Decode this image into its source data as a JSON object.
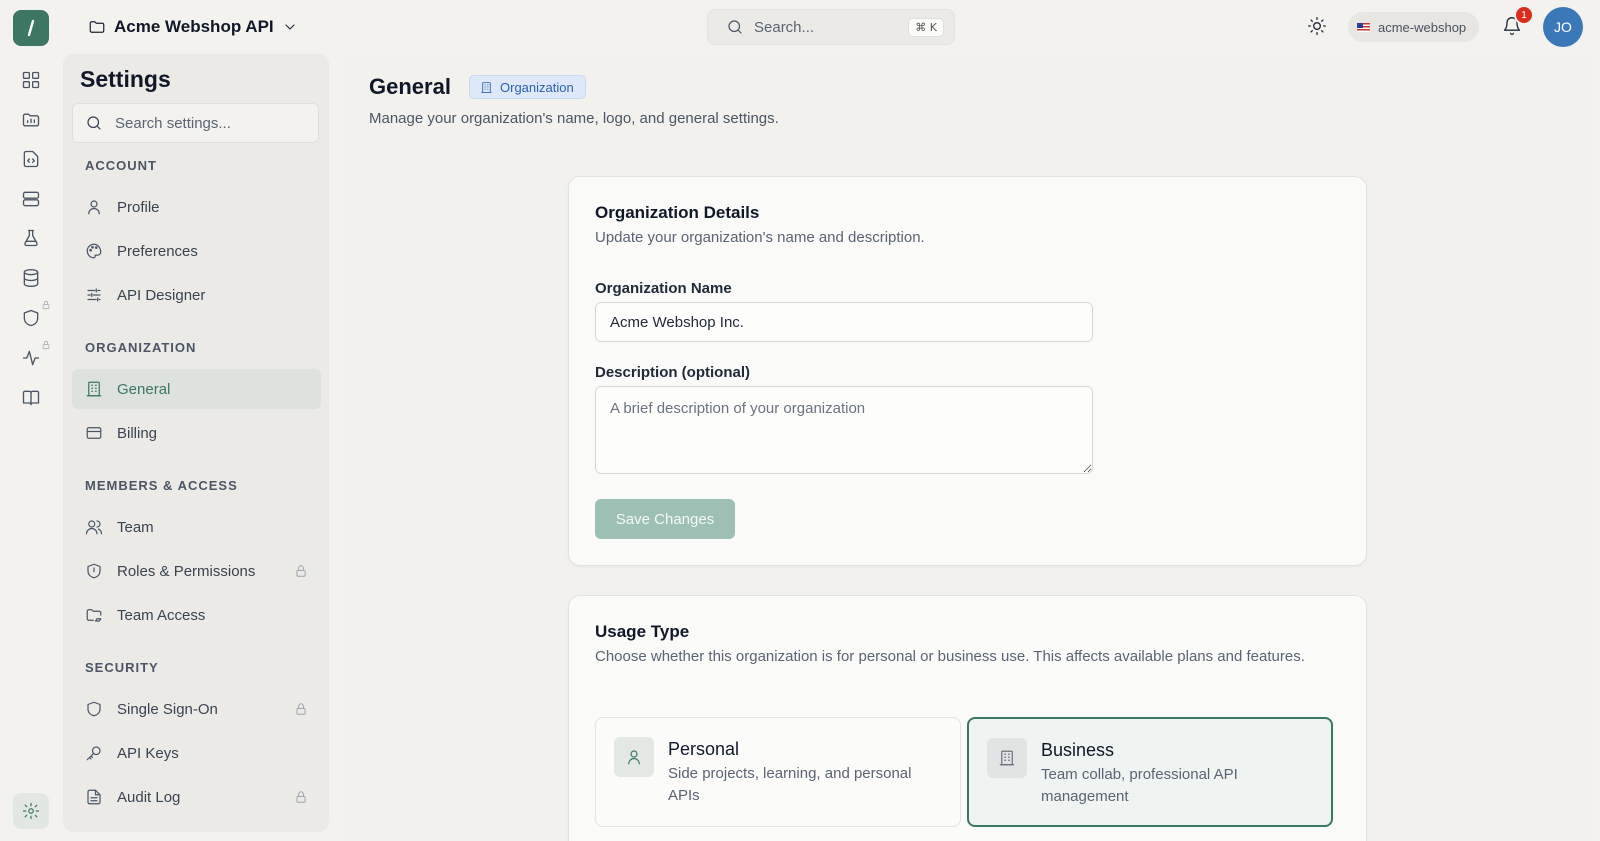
{
  "app": {
    "project_name": "Acme Webshop API",
    "search_placeholder": "Search...",
    "search_shortcut": "⌘ K",
    "org_slug": "acme-webshop",
    "notification_count": "1",
    "avatar_initials": "JO",
    "accent_color": "#3d7663"
  },
  "rail": {
    "icons": [
      "dashboard-icon",
      "folder-chart-icon",
      "file-code-icon",
      "server-icon",
      "flask-icon",
      "database-icon",
      "shield-icon",
      "activity-icon",
      "book-icon",
      "settings-icon"
    ]
  },
  "settings_nav": {
    "title": "Settings",
    "search_placeholder": "Search settings...",
    "sections": {
      "account": "ACCOUNT",
      "organization": "ORGANIZATION",
      "members": "MEMBERS & ACCESS",
      "security": "SECURITY"
    },
    "items": {
      "profile": "Profile",
      "preferences": "Preferences",
      "api_designer": "API Designer",
      "general": "General",
      "billing": "Billing",
      "team": "Team",
      "roles": "Roles & Permissions",
      "team_access": "Team Access",
      "sso": "Single Sign-On",
      "api_keys": "API Keys",
      "audit_log": "Audit Log"
    }
  },
  "page": {
    "title": "General",
    "badge": "Organization",
    "subtitle": "Manage your organization's name, logo, and general settings."
  },
  "org_details": {
    "title": "Organization Details",
    "subtitle": "Update your organization's name and description.",
    "name_label": "Organization Name",
    "name_value": "Acme Webshop Inc.",
    "description_label": "Description (optional)",
    "description_placeholder": "A brief description of your organization",
    "save_label": "Save Changes"
  },
  "usage_type": {
    "title": "Usage Type",
    "subtitle": "Choose whether this organization is for personal or business use. This affects available plans and features.",
    "personal_title": "Personal",
    "personal_desc": "Side projects, learning, and personal APIs",
    "business_title": "Business",
    "business_desc": "Team collab, professional API management",
    "selected": "Business"
  }
}
